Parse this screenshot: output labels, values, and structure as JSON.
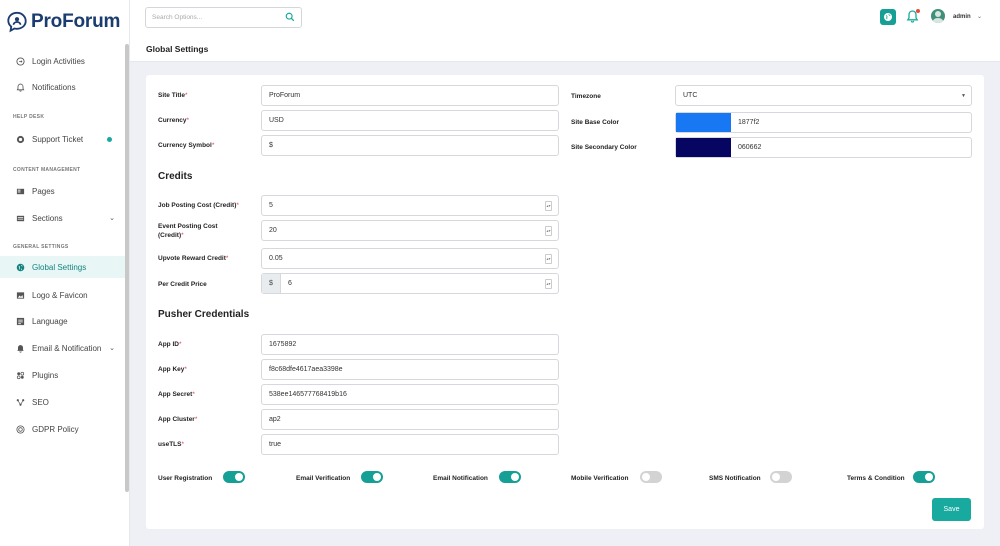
{
  "app": {
    "name": "ProForum"
  },
  "sidebar": {
    "items": [
      {
        "label": "Login Activities",
        "icon": "login-icon"
      },
      {
        "label": "Notifications",
        "icon": "bell-icon"
      },
      {
        "label": "Support Ticket",
        "icon": "ticket-icon",
        "dot": true
      },
      {
        "label": "Pages",
        "icon": "pages-icon"
      },
      {
        "label": "Sections",
        "icon": "sections-icon",
        "chevron": true
      },
      {
        "label": "Global Settings",
        "icon": "globe-icon",
        "active": true
      },
      {
        "label": "Logo & Favicon",
        "icon": "image-icon"
      },
      {
        "label": "Language",
        "icon": "language-icon"
      },
      {
        "label": "Email & Notification",
        "icon": "email-bell-icon",
        "chevron": true
      },
      {
        "label": "Plugins",
        "icon": "plugins-icon"
      },
      {
        "label": "SEO",
        "icon": "seo-icon"
      },
      {
        "label": "GDPR Policy",
        "icon": "gdpr-icon"
      }
    ],
    "sections": {
      "help_desk": "HELP DESK",
      "content_management": "CONTENT MANAGEMENT",
      "general_settings": "GENERAL SETTINGS"
    }
  },
  "topbar": {
    "search_placeholder": "Search Options...",
    "page_title": "Global Settings",
    "user": "admin"
  },
  "form": {
    "site_title": {
      "label": "Site Title",
      "value": "ProForum"
    },
    "currency": {
      "label": "Currency",
      "value": "USD"
    },
    "currency_symbol": {
      "label": "Currency Symbol",
      "value": "$"
    },
    "timezone": {
      "label": "Timezone",
      "value": "UTC"
    },
    "base_color": {
      "label": "Site Base Color",
      "value": "1877f2",
      "swatch": "#1877f2"
    },
    "secondary_color": {
      "label": "Site Secondary Color",
      "value": "060662",
      "swatch": "#060662"
    },
    "credits_title": "Credits",
    "job_cost": {
      "label": "Job Posting Cost (Credit)",
      "value": "5"
    },
    "event_cost_l1": "Event Posting Cost",
    "event_cost_l2": "(Credit)",
    "event_cost_value": "20",
    "upvote": {
      "label": "Upvote Reward Credit",
      "value": "0.05"
    },
    "per_credit": {
      "label": "Per Credit Price",
      "prefix": "$",
      "value": "6"
    },
    "pusher_title": "Pusher Credentials",
    "app_id": {
      "label": "App ID",
      "value": "1675892"
    },
    "app_key": {
      "label": "App Key",
      "value": "f8c68dfe4617aea3398e"
    },
    "app_secret": {
      "label": "App Secret",
      "value": "538ee146577768419b16"
    },
    "app_cluster": {
      "label": "App Cluster",
      "value": "ap2"
    },
    "use_tls": {
      "label": "useTLS",
      "value": "true"
    },
    "required_mark": "*"
  },
  "toggles": [
    {
      "label": "User Registration",
      "on": true
    },
    {
      "label": "Email Verification",
      "on": true
    },
    {
      "label": "Email Notification",
      "on": true
    },
    {
      "label": "Mobile Verification",
      "on": false
    },
    {
      "label": "SMS Notification",
      "on": false
    },
    {
      "label": "Terms & Condition",
      "on": true
    }
  ],
  "save_label": "Save",
  "colors": {
    "accent": "#18a99f",
    "brand": "#1a3c6e",
    "danger": "#e74c3c"
  }
}
